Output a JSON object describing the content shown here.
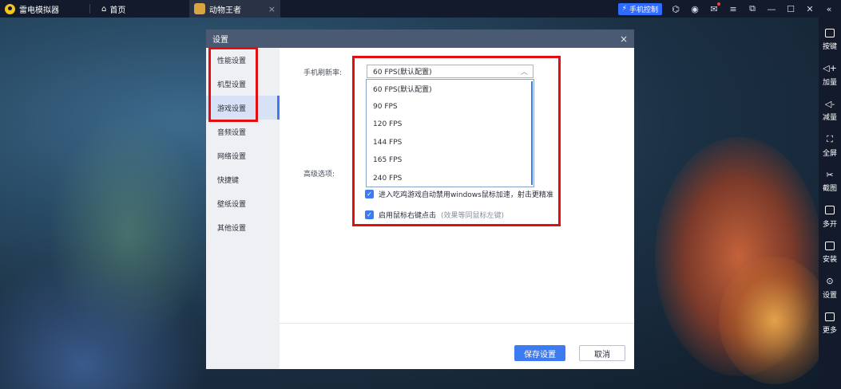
{
  "titlebar": {
    "app_name": "雷电模拟器",
    "home_label": "首页",
    "tab_label": "动物王者",
    "tab_close": "×",
    "phone_control": "手机控制",
    "icons": [
      "gamepad-icon",
      "record-icon",
      "mail-icon",
      "menu-icon",
      "restore-icon",
      "minimize-icon",
      "maximize-icon",
      "close-icon",
      "collapse-icon"
    ]
  },
  "sidebar": {
    "items": [
      {
        "label": "按键",
        "icon": "keyboard-icon"
      },
      {
        "label": "加量",
        "icon": "volume-up-icon"
      },
      {
        "label": "减量",
        "icon": "volume-down-icon"
      },
      {
        "label": "全屏",
        "icon": "fullscreen-icon"
      },
      {
        "label": "截图",
        "icon": "scissors-icon"
      },
      {
        "label": "多开",
        "icon": "multi-instance-icon"
      },
      {
        "label": "安装",
        "icon": "apk-icon"
      },
      {
        "label": "设置",
        "icon": "settings-icon"
      },
      {
        "label": "更多",
        "icon": "more-icon"
      }
    ]
  },
  "dialog": {
    "title": "设置",
    "close": "×",
    "nav": [
      "性能设置",
      "机型设置",
      "游戏设置",
      "音频设置",
      "网络设置",
      "快捷键",
      "壁纸设置",
      "其他设置"
    ],
    "active_nav": "游戏设置",
    "refresh_rate_label": "手机刷新率:",
    "refresh_rate_value": "60 FPS(默认配置)",
    "refresh_rate_options": [
      "60 FPS(默认配置)",
      "90 FPS",
      "120 FPS",
      "144 FPS",
      "165 FPS",
      "240 FPS"
    ],
    "advanced_label": "高级选项:",
    "checkbox1": "进入吃鸡游戏自动禁用windows鼠标加速，射击更精准",
    "checkbox2": "启用鼠标右键点击",
    "checkbox2_hint": "(效果等同鼠标左键)",
    "save_button": "保存设置",
    "cancel_button": "取消"
  },
  "colors": {
    "accent": "#3d7cf0",
    "annotation_red": "#e10f0f",
    "titlebar_bg": "#121a2b",
    "dialog_header": "#4b5a73"
  }
}
